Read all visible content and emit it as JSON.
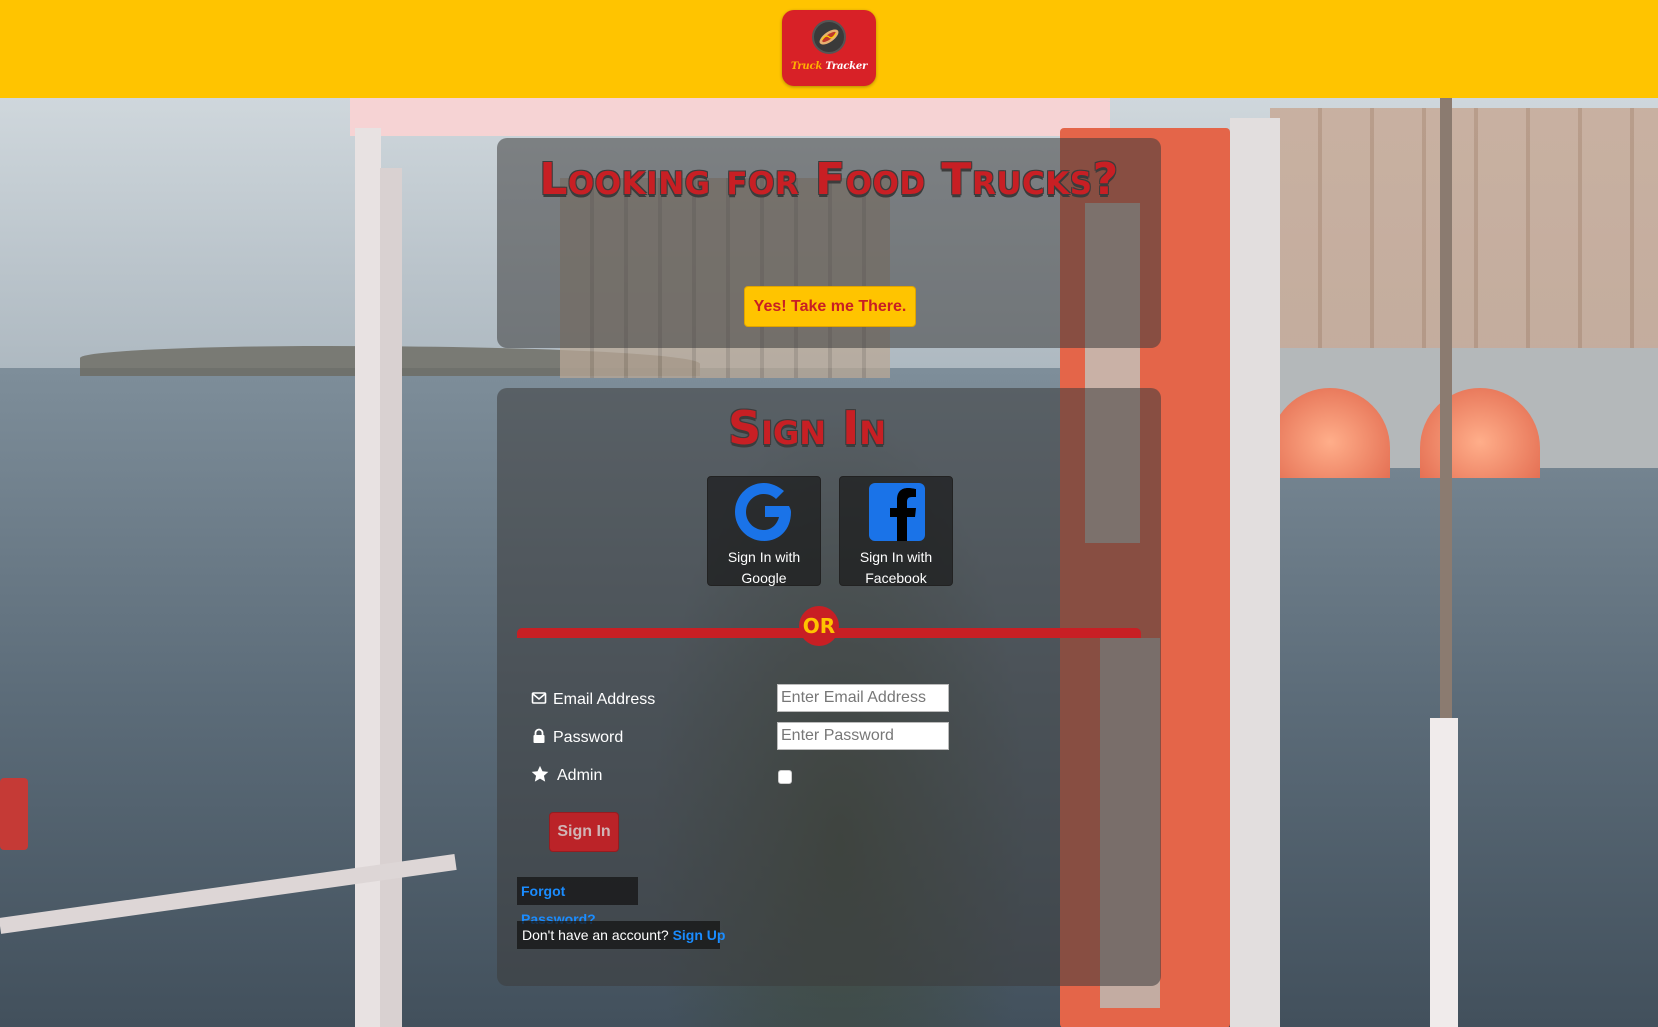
{
  "brand": {
    "logo_word1": "Truck",
    "logo_word2": "Tracker",
    "header_color": "#ffc400",
    "accent_red": "#c81f24",
    "link_blue": "#1a8cff"
  },
  "hero": {
    "headline": "Looking for Food Trucks?",
    "cta_label": "Yes! Take me There."
  },
  "signin": {
    "title": "Sign In",
    "google_label": "Sign In with Google",
    "facebook_label": "Sign In with Facebook",
    "divider_text": "OR",
    "email_label": "Email Address",
    "email_placeholder": "Enter Email Address",
    "password_label": "Password",
    "password_placeholder": "Enter Password",
    "admin_label": "Admin",
    "submit_label": "Sign In",
    "forgot_label": "Forgot Password?",
    "no_account_text": "Don't have an account?",
    "signup_label": "Sign Up"
  },
  "icons": {
    "logo": "hotdog-icon",
    "google": "google-icon",
    "facebook": "facebook-icon",
    "email": "envelope-icon",
    "password": "lock-icon",
    "admin": "star-icon"
  }
}
